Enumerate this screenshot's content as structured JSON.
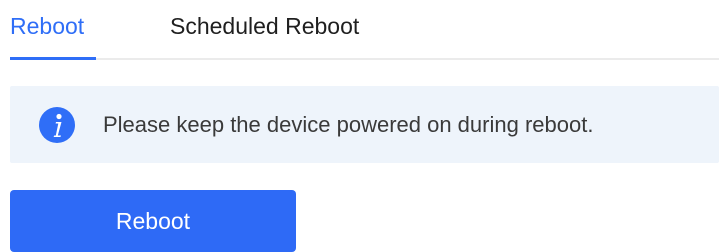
{
  "tabs": [
    {
      "label": "Reboot",
      "active": true
    },
    {
      "label": "Scheduled Reboot",
      "active": false
    }
  ],
  "notice": {
    "icon": "info-icon",
    "text": "Please keep the device powered on during reboot."
  },
  "actions": {
    "reboot_label": "Reboot"
  },
  "colors": {
    "accent": "#2f6ef7",
    "notice_background": "#eef4fb",
    "button_background": "#2e6af6"
  }
}
